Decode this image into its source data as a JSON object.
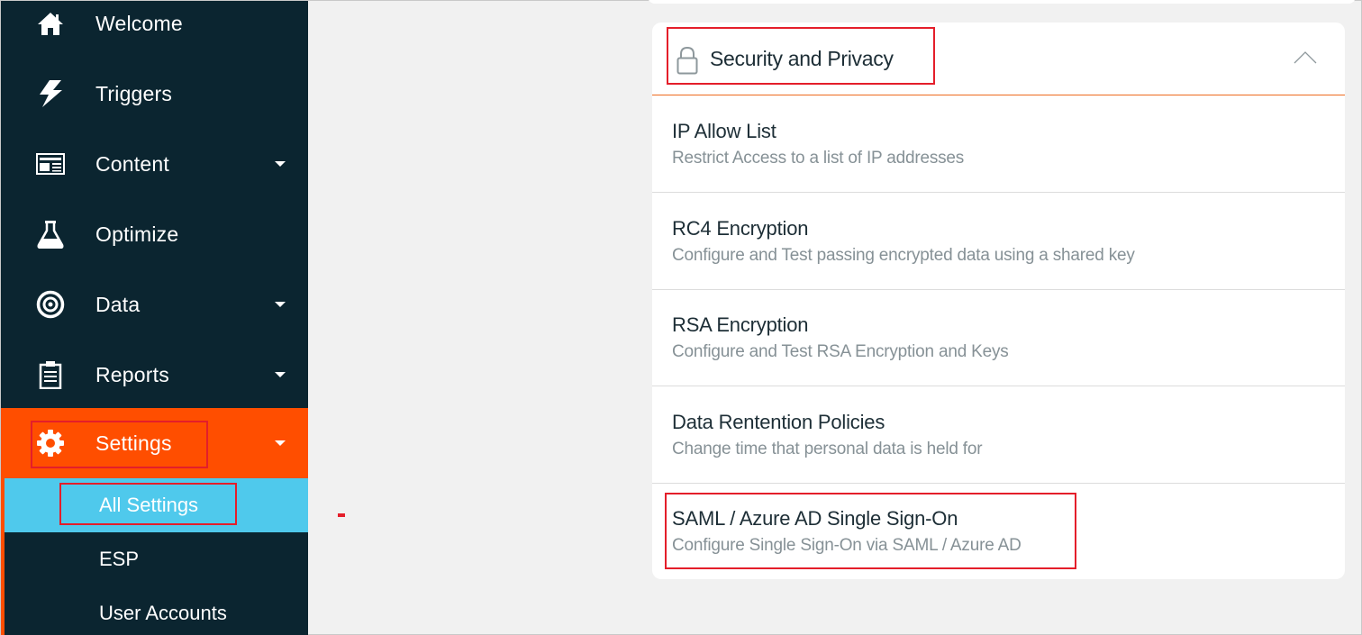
{
  "sidebar": {
    "items": [
      {
        "label": "Welcome",
        "icon": "home-icon",
        "has_caret": false
      },
      {
        "label": "Triggers",
        "icon": "lightning-icon",
        "has_caret": false
      },
      {
        "label": "Content",
        "icon": "newspaper-icon",
        "has_caret": true
      },
      {
        "label": "Optimize",
        "icon": "flask-icon",
        "has_caret": false
      },
      {
        "label": "Data",
        "icon": "target-icon",
        "has_caret": true
      },
      {
        "label": "Reports",
        "icon": "clipboard-icon",
        "has_caret": true
      },
      {
        "label": "Settings",
        "icon": "gear-icon",
        "has_caret": true,
        "expanded": true
      }
    ],
    "settings_subitems": [
      {
        "label": "All Settings",
        "active": true
      },
      {
        "label": "ESP",
        "active": false
      },
      {
        "label": "User Accounts",
        "active": false
      }
    ]
  },
  "panel": {
    "title": "Security and Privacy",
    "icon": "lock-icon",
    "collapse_icon": "chevron-up-icon",
    "rows": [
      {
        "title": "IP Allow List",
        "description": "Restrict Access to a list of IP addresses"
      },
      {
        "title": "RC4 Encryption",
        "description": "Configure and Test passing encrypted data using a shared key"
      },
      {
        "title": "RSA Encryption",
        "description": "Configure and Test RSA Encryption and Keys"
      },
      {
        "title": "Data Rentention Policies",
        "description": "Change time that personal data is held for"
      },
      {
        "title": "SAML / Azure AD Single Sign-On",
        "description": "Configure Single Sign-On via SAML / Azure AD"
      }
    ]
  },
  "colors": {
    "sidebar_bg": "#0b2530",
    "settings_accent": "#ff4e00",
    "active_subitem": "#4fc9ec",
    "annotation_red": "#e41e2a",
    "divider_orange": "#ee6a1e"
  }
}
